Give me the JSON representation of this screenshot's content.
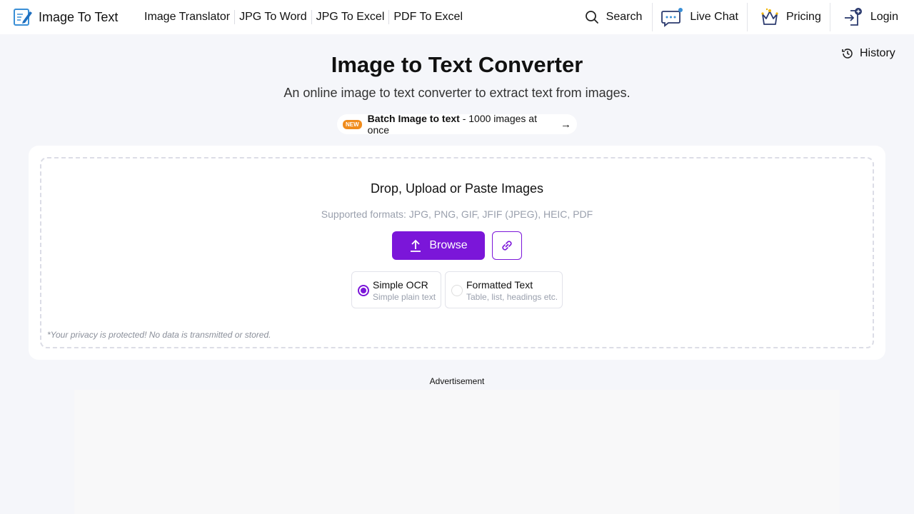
{
  "brand": {
    "label": "Image To Text",
    "icon": "notepad-pen-icon"
  },
  "nav": {
    "links": [
      "Image Translator",
      "JPG To Word",
      "JPG To Excel",
      "PDF To Excel"
    ]
  },
  "right_nav": {
    "search": "Search",
    "live_chat": "Live Chat",
    "pricing": "Pricing",
    "login": "Login"
  },
  "history": {
    "label": "History"
  },
  "hero": {
    "title": "Image to Text Converter",
    "subtitle": "An online image to text converter to extract text from images."
  },
  "batch": {
    "badge": "NEW",
    "bold": "Batch Image to text",
    "rest": " - 1000 images at once",
    "arrow": "→"
  },
  "upload": {
    "title": "Drop, Upload or Paste Images",
    "formats": "Supported formats: JPG, PNG, GIF, JFIF (JPEG), HEIC, PDF",
    "browse_label": "Browse",
    "options": [
      {
        "title": "Simple OCR",
        "desc": "Simple plain text",
        "selected": true
      },
      {
        "title": "Formatted Text",
        "desc": "Table, list, headings etc.",
        "selected": false
      }
    ],
    "privacy": "*Your privacy is protected! No data is transmitted or stored."
  },
  "ad": {
    "label": "Advertisement"
  },
  "colors": {
    "accent": "#7b16d9",
    "badge": "#f08c1d",
    "background": "#f5f6fa"
  }
}
